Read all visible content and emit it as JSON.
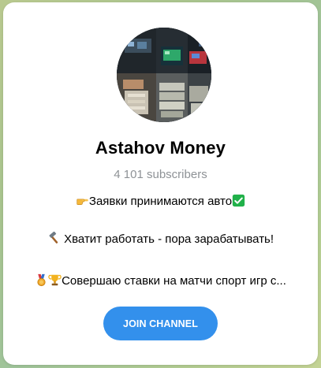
{
  "channel": {
    "title": "Astahov Money",
    "subscribers": "4 101 subscribers",
    "avatar_icon": "channel-avatar-collage"
  },
  "description": {
    "line1": {
      "emoji_start": "pointing-right-hand-icon",
      "text": "Заявки принимаются авто",
      "emoji_end": "check-mark-icon"
    },
    "line2": {
      "emoji_start": "hammer-icon",
      "text": " Хватит работать - пора зарабатывать!"
    },
    "line3": {
      "emoji_start": "medal-icon",
      "emoji_second": "trophy-icon",
      "text": "Совершаю ставки на матчи спорт игр с..."
    }
  },
  "actions": {
    "join_label": "JOIN CHANNEL"
  },
  "colors": {
    "accent": "#3390ec",
    "subtle_text": "#8e9296",
    "check": "#21b14a"
  }
}
